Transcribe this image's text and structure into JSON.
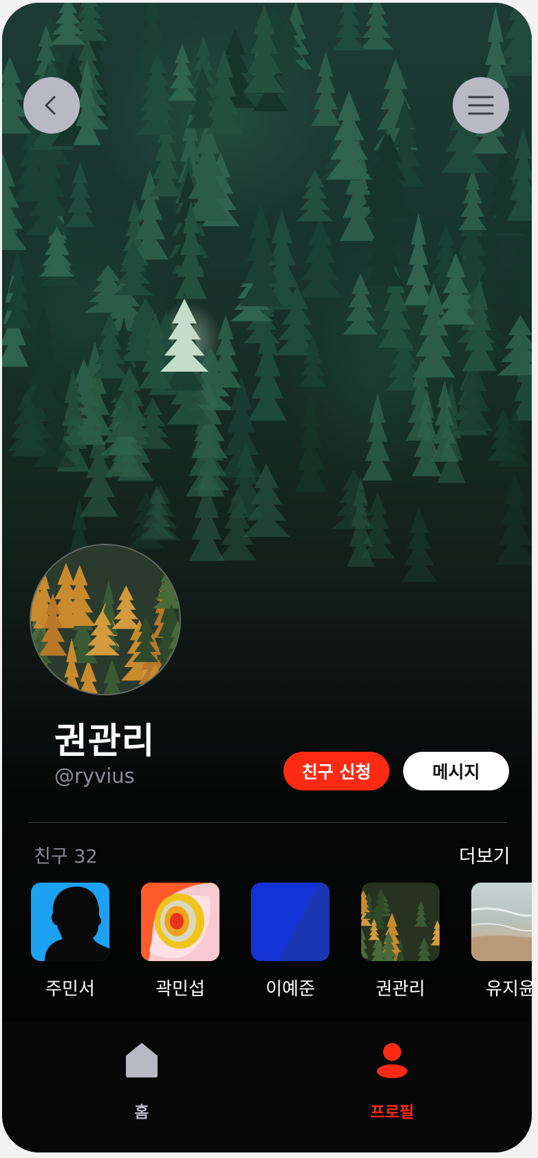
{
  "profile": {
    "name": "권관리",
    "handle": "@ryvius"
  },
  "actions": {
    "friend_request_label": "친구 신청",
    "message_label": "메시지"
  },
  "friends": {
    "count_label": "친구 32",
    "more_label": "더보기",
    "items": [
      {
        "name": "주민서"
      },
      {
        "name": "곽민섭"
      },
      {
        "name": "이예준"
      },
      {
        "name": "권관리"
      },
      {
        "name": "유지윤"
      }
    ]
  },
  "nav": {
    "items": [
      {
        "label": "홈",
        "icon": "home-icon",
        "active": false
      },
      {
        "label": "프로필",
        "icon": "profile-icon",
        "active": true
      }
    ]
  },
  "colors": {
    "accent": "#ff2a14",
    "inactive_icon": "#b9b9c4",
    "background": "#050505"
  }
}
